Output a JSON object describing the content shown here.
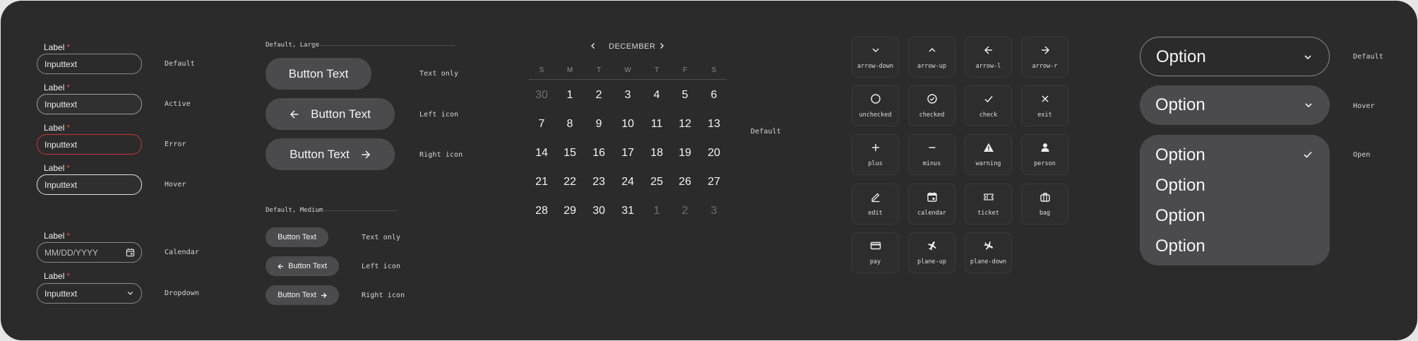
{
  "inputs": {
    "default": {
      "label": "Label",
      "required": "*",
      "value": "Inputtext",
      "state": "Default"
    },
    "active": {
      "label": "Label",
      "required": "*",
      "value": "Inputtext",
      "state": "Active"
    },
    "error": {
      "label": "Label",
      "required": "*",
      "value": "Inputtext",
      "state": "Error"
    },
    "hover": {
      "label": "Label",
      "required": "*",
      "value": "Inputtext",
      "state": "Hover"
    },
    "calendar": {
      "label": "Label",
      "required": "*",
      "placeholder": "MM/DD/YYYY",
      "state": "Calendar"
    },
    "dropdown": {
      "label": "Label",
      "required": "*",
      "value": "Inputtext",
      "state": "Dropdown"
    }
  },
  "buttons": {
    "large_title": "Default, Large",
    "medium_title": "Default, Medium",
    "label": "Button Text",
    "variants": {
      "text_only": "Text only",
      "left_icon": "Left icon",
      "right_icon": "Right icon"
    }
  },
  "calendar": {
    "month": "DECEMBER",
    "state": "Default",
    "weekdays": [
      "S",
      "M",
      "T",
      "W",
      "T",
      "F",
      "S"
    ],
    "weeks": [
      [
        "30",
        "1",
        "2",
        "3",
        "4",
        "5",
        "6"
      ],
      [
        "7",
        "8",
        "9",
        "10",
        "11",
        "12",
        "13"
      ],
      [
        "14",
        "15",
        "16",
        "17",
        "18",
        "19",
        "20"
      ],
      [
        "21",
        "22",
        "23",
        "24",
        "25",
        "26",
        "27"
      ],
      [
        "28",
        "29",
        "30",
        "31",
        "1",
        "2",
        "3"
      ]
    ],
    "muted": [
      [
        0,
        0
      ],
      [
        4,
        4
      ],
      [
        4,
        5
      ],
      [
        4,
        6
      ]
    ]
  },
  "icons": [
    {
      "name": "arrow-down",
      "label": "arrow-down"
    },
    {
      "name": "arrow-up",
      "label": "arrow-up"
    },
    {
      "name": "arrow-l",
      "label": "arrow-l"
    },
    {
      "name": "arrow-r",
      "label": "arrow-r"
    },
    {
      "name": "unchecked",
      "label": "unchecked"
    },
    {
      "name": "checked",
      "label": "checked"
    },
    {
      "name": "check",
      "label": "check"
    },
    {
      "name": "exit",
      "label": "exit"
    },
    {
      "name": "plus",
      "label": "plus"
    },
    {
      "name": "minus",
      "label": "minus"
    },
    {
      "name": "warning",
      "label": "warning"
    },
    {
      "name": "person",
      "label": "person"
    },
    {
      "name": "edit",
      "label": "edit"
    },
    {
      "name": "calendar",
      "label": "calendar"
    },
    {
      "name": "ticket",
      "label": "ticket"
    },
    {
      "name": "bag",
      "label": "bag"
    },
    {
      "name": "pay",
      "label": "pay"
    },
    {
      "name": "plane-up",
      "label": "plane-up"
    },
    {
      "name": "plane-down",
      "label": "plane-down"
    }
  ],
  "select": {
    "default": {
      "value": "Option",
      "state": "Default"
    },
    "hover": {
      "value": "Option",
      "state": "Hover"
    },
    "open": {
      "options": [
        "Option",
        "Option",
        "Option",
        "Option"
      ],
      "state": "Open"
    }
  },
  "colors": {
    "panel_bg": "#2b2b2c",
    "button_bg": "#4b4b4d",
    "error": "#c6373a",
    "required": "#e0493f"
  }
}
